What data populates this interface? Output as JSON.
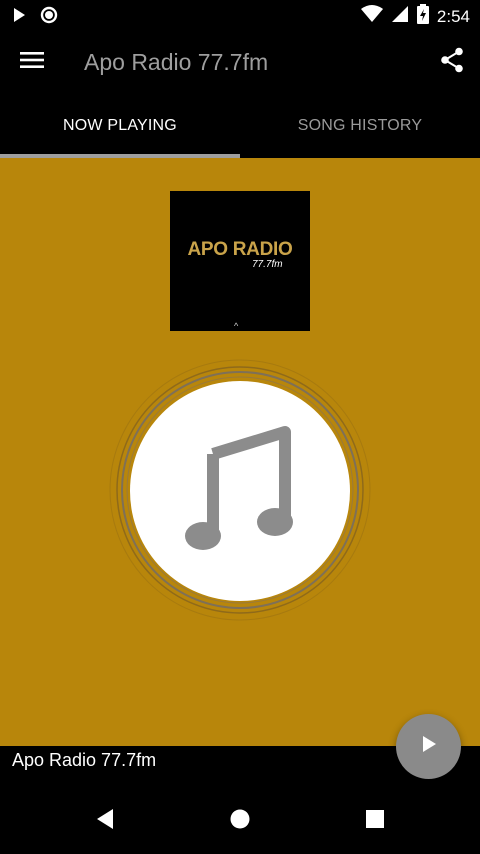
{
  "status_bar": {
    "time": "2:54",
    "icons": [
      "play-icon",
      "record-icon",
      "wifi-icon",
      "signal-icon",
      "battery-icon"
    ]
  },
  "app_bar": {
    "title": "Apo Radio 77.7fm",
    "menu_icon": "menu-icon",
    "share_icon": "share-icon"
  },
  "tabs": [
    {
      "label": "NOW PLAYING",
      "active": true
    },
    {
      "label": "SONG HISTORY",
      "active": false
    }
  ],
  "main": {
    "background": "#b8860b",
    "logo": {
      "text": "APO RADIO",
      "sub": "77.7fm"
    },
    "art_icon": "music-note-icon"
  },
  "now_playing_bar": {
    "station": "Apo Radio 77.7fm",
    "play_icon": "play-icon"
  },
  "nav_bar": {
    "icons": [
      "back-icon",
      "home-icon",
      "recents-icon"
    ]
  },
  "colors": {
    "accent": "#b8860b",
    "fab": "#8a8a8a",
    "tab_indicator": "#9e9e9e"
  }
}
